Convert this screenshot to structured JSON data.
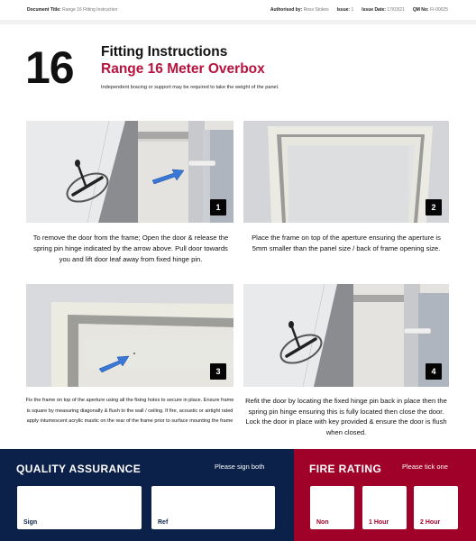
{
  "header": {
    "document_title_label": "Document Title:",
    "document_title": "Range 16 Fitting Instruction",
    "authorised_label": "Authorised by:",
    "authorised": "Ross Stokes",
    "issue_label": "Issue:",
    "issue": "1",
    "issue_date_label": "Issue Date:",
    "issue_date": "17/03/21",
    "qm_label": "QM No:",
    "qm": "FI-00025"
  },
  "hero": {
    "number": "16",
    "title": "Fitting Instructions",
    "subtitle": "Range 16 Meter Overbox",
    "note": "Independent bracing or support may be required to take the weight of the panel."
  },
  "steps": [
    {
      "number": "1",
      "caption": "To remove the door from the frame; Open the door & release the spring pin hinge indicated by the arrow above. Pull door towards you and lift door leaf away from fixed hinge pin."
    },
    {
      "number": "2",
      "caption": "Place the frame on top of the aperture ensuring the aperture is 5mm smaller than the panel size / back of frame opening size."
    },
    {
      "number": "3",
      "caption": "Fix the frame on top of the aperture using all the fixing holes to secure in place. Ensure frame is square by measuring diagonally & flush to the wall / ceiling. If fire, acoustic or airtight rated apply intumescent acrylic mastic on the rear of the frame prior to surface mounting the frame"
    },
    {
      "number": "4",
      "caption": "Refit the door by locating the fixed hinge pin back in place then the spring pin hinge ensuring this is fully located then close the door. Lock the door in place with key provided & ensure the door is flush when closed."
    }
  ],
  "quality_assurance": {
    "title": "QUALITY ASSURANCE",
    "hint": "Please sign both",
    "fields": [
      "Sign",
      "Ref"
    ]
  },
  "fire_rating": {
    "title": "FIRE RATING",
    "hint": "Please tick one",
    "options": [
      "Non",
      "1 Hour",
      "2 Hour"
    ]
  },
  "colors": {
    "brand_red": "#b8123e",
    "qa_navy": "#0c2149",
    "fire_red": "#a00128",
    "arrow_blue": "#3a78d8"
  }
}
